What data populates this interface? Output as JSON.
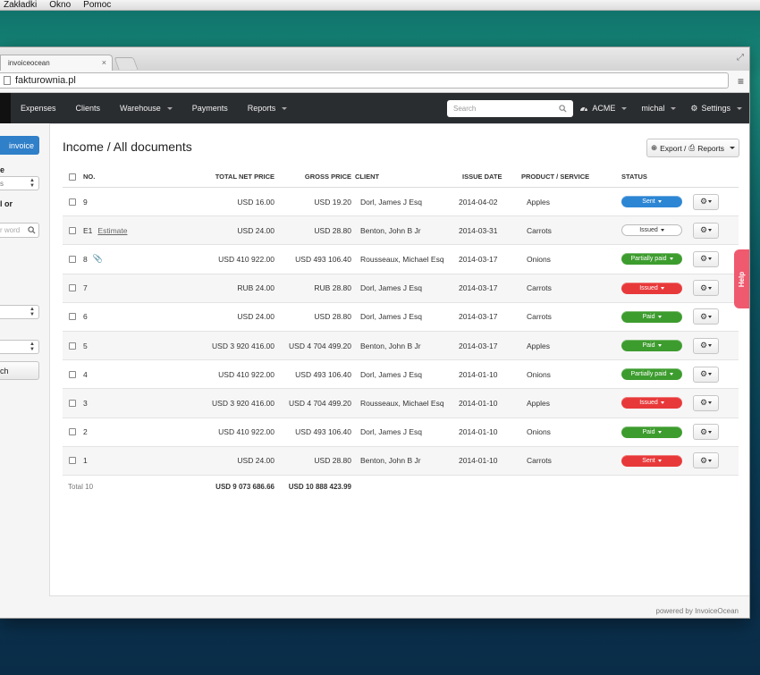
{
  "os_menu": [
    "Zakładki",
    "Okno",
    "Pomoc"
  ],
  "browser": {
    "tab_title": "invoiceocean",
    "tab_close": "×",
    "address": "fakturownia.pl"
  },
  "nav": {
    "items": [
      {
        "label": "Expenses",
        "caret": false
      },
      {
        "label": "Clients",
        "caret": false
      },
      {
        "label": "Warehouse",
        "caret": true
      },
      {
        "label": "Payments",
        "caret": false
      },
      {
        "label": "Reports",
        "caret": true
      }
    ],
    "search_placeholder": "Search",
    "account": "ACME",
    "user": "michal",
    "settings": "Settings"
  },
  "sidebar": {
    "new_button": "invoice",
    "label1": "e",
    "select1": "s",
    "label2": "l or",
    "search_placeholder": "r word",
    "search_button": "ch"
  },
  "main": {
    "title": "Income / All documents",
    "export_label": "Export /",
    "reports_label": "Reports",
    "columns": {
      "no": "NO.",
      "net": "TOTAL NET PRICE",
      "gross": "GROSS PRICE",
      "client": "CLIENT",
      "date": "ISSUE DATE",
      "product": "PRODUCT / SERVICE",
      "status": "STATUS"
    },
    "rows": [
      {
        "no": "9",
        "sub": "",
        "attach": false,
        "net": "USD 16.00",
        "gross": "USD 19.20",
        "client": "Dorl, James J Esq",
        "date": "2014-04-02",
        "product": "Apples",
        "status": "Sent",
        "status_color": "#2d86d4"
      },
      {
        "no": "E1",
        "sub": "Estimate",
        "attach": false,
        "net": "USD 24.00",
        "gross": "USD 28.80",
        "client": "Benton, John B Jr",
        "date": "2014-03-31",
        "product": "Carrots",
        "status": "Issued",
        "status_color": "#ffffff"
      },
      {
        "no": "8",
        "sub": "",
        "attach": true,
        "net": "USD 410 922.00",
        "gross": "USD 493 106.40",
        "client": "Rousseaux, Michael Esq",
        "date": "2014-03-17",
        "product": "Onions",
        "status": "Partially paid",
        "status_color": "#3d9c2e"
      },
      {
        "no": "7",
        "sub": "",
        "attach": false,
        "net": "RUB 24.00",
        "gross": "RUB 28.80",
        "client": "Dorl, James J Esq",
        "date": "2014-03-17",
        "product": "Carrots",
        "status": "Issued",
        "status_color": "#e8393a"
      },
      {
        "no": "6",
        "sub": "",
        "attach": false,
        "net": "USD 24.00",
        "gross": "USD 28.80",
        "client": "Dorl, James J Esq",
        "date": "2014-03-17",
        "product": "Carrots",
        "status": "Paid",
        "status_color": "#3d9c2e"
      },
      {
        "no": "5",
        "sub": "",
        "attach": false,
        "net": "USD 3 920 416.00",
        "gross": "USD 4 704 499.20",
        "client": "Benton, John B Jr",
        "date": "2014-03-17",
        "product": "Apples",
        "status": "Paid",
        "status_color": "#3d9c2e"
      },
      {
        "no": "4",
        "sub": "",
        "attach": false,
        "net": "USD 410 922.00",
        "gross": "USD 493 106.40",
        "client": "Dorl, James J Esq",
        "date": "2014-01-10",
        "product": "Onions",
        "status": "Partially paid",
        "status_color": "#3d9c2e"
      },
      {
        "no": "3",
        "sub": "",
        "attach": false,
        "net": "USD 3 920 416.00",
        "gross": "USD 4 704 499.20",
        "client": "Rousseaux, Michael Esq",
        "date": "2014-01-10",
        "product": "Apples",
        "status": "Issued",
        "status_color": "#e8393a"
      },
      {
        "no": "2",
        "sub": "",
        "attach": false,
        "net": "USD 410 922.00",
        "gross": "USD 493 106.40",
        "client": "Dorl, James J Esq",
        "date": "2014-01-10",
        "product": "Onions",
        "status": "Paid",
        "status_color": "#3d9c2e"
      },
      {
        "no": "1",
        "sub": "",
        "attach": false,
        "net": "USD 24.00",
        "gross": "USD 28.80",
        "client": "Benton, John B Jr",
        "date": "2014-01-10",
        "product": "Carrots",
        "status": "Sent",
        "status_color": "#e8393a"
      }
    ],
    "totals": {
      "label": "Total 10",
      "net": "USD 9 073 686.66",
      "gross": "USD 10 888 423.99"
    }
  },
  "footer": {
    "powered": "powered by InvoiceOcean"
  },
  "help": "Help"
}
